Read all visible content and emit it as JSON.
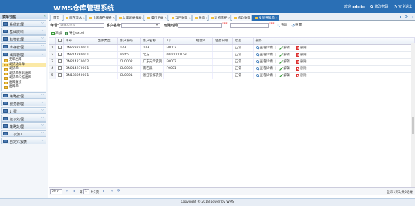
{
  "header": {
    "title": "WMS仓库管理系统",
    "welcome": "欢迎",
    "user": "admin",
    "change_password": "修改密码",
    "logout": "安全退出"
  },
  "sidebar": {
    "title": "菜单导航",
    "categories": [
      "系统管理",
      "基础资料",
      "标签管理",
      "库存管理",
      "出库管理",
      "策略管理",
      "服务管理",
      "计费",
      "波次处理",
      "策略处理",
      "二次加工",
      "自定义报表"
    ],
    "submenu": [
      "无单出库",
      "发货通知单",
      "发货单",
      "发货单条码出库",
      "发货单扫描出库",
      "出库复核",
      "出库单"
    ]
  },
  "tabs": [
    {
      "label": "首页"
    },
    {
      "label": "库存流水"
    },
    {
      "label": "出库库存报表"
    },
    {
      "label": "入库记录报表"
    },
    {
      "label": "操作记录"
    },
    {
      "label": "当月账单"
    },
    {
      "label": "账单"
    },
    {
      "label": "计费库存"
    },
    {
      "label": "修改账单"
    },
    {
      "label": "发货通知单"
    }
  ],
  "search": {
    "no_label": "单号:",
    "no_placeholder": "请输入单号",
    "customer_label": "客户名称:",
    "date_label": "创建时间:",
    "req1": "***",
    "req2": "***",
    "query": "查询",
    "reset": "重置"
  },
  "toolbar": {
    "add": "添加",
    "export": "导出excel"
  },
  "table": {
    "headers": [
      "",
      "",
      "单号",
      "出库类型",
      "客户编码",
      "客户名称",
      "工厂",
      "经营人",
      "经营日期",
      "状态",
      "操作"
    ],
    "rows": [
      {
        "no": "1",
        "order": "ON223240001",
        "type": "",
        "ccode": "123",
        "cname": "123",
        "factory": "F0002",
        "op": "",
        "date": "",
        "status": "正常"
      },
      {
        "no": "2",
        "order": "ON214280001",
        "type": "",
        "ccode": "north",
        "cname": "北方",
        "factory": "0000000168",
        "op": "",
        "date": "",
        "status": "正常"
      },
      {
        "no": "3",
        "order": "ON214270002",
        "type": "",
        "ccode": "CU0002",
        "cname": "广东天禾农资",
        "factory": "F0002",
        "op": "",
        "date": "",
        "status": "正常"
      },
      {
        "no": "4",
        "order": "ON214270001",
        "type": "",
        "ccode": "CU0003",
        "cname": "南巴黑",
        "factory": "F0001",
        "op": "",
        "date": "",
        "status": "正常"
      },
      {
        "no": "5",
        "order": "ON188050001",
        "type": "",
        "ccode": "CU0001",
        "cname": "浙江农作农资",
        "factory": "",
        "op": "",
        "date": "",
        "status": "正常"
      }
    ],
    "actions": {
      "view": "查看详情",
      "edit": "编辑",
      "delete": "删除"
    }
  },
  "pager": {
    "page_size": "20",
    "page": "1",
    "page_of": "共1页",
    "summary": "显示1到5,共5记录"
  },
  "footer": "Copyright © 2018 power by WMS",
  "colors": {
    "brand": "#2a6fb5",
    "view": "#2a6fb5",
    "edit": "#3a9a3a",
    "delete": "#d33"
  }
}
